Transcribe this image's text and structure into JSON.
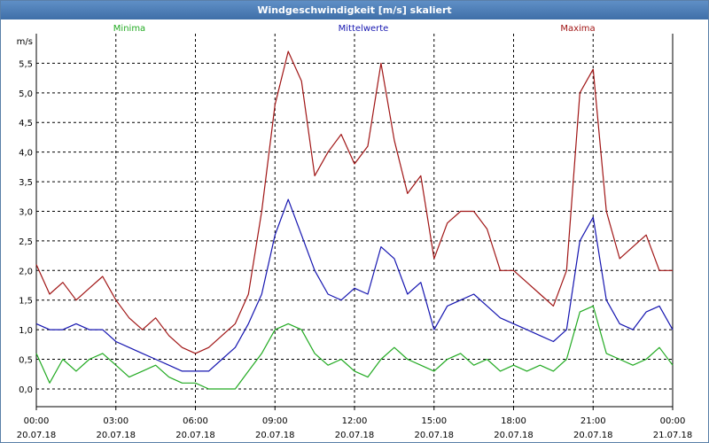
{
  "window": {
    "title": "Windgeschwindigkeit [m/s] skaliert"
  },
  "chart_data": {
    "type": "line",
    "title": "Windgeschwindigkeit [m/s] skaliert",
    "ylabel": "m/s",
    "xlabel": "",
    "ylim": [
      -0.3,
      6.0
    ],
    "xlim": [
      0,
      24
    ],
    "grid": true,
    "legend_position": "top",
    "y_ticks": [
      "0,0",
      "0,5",
      "1,0",
      "1,5",
      "2,0",
      "2,5",
      "3,0",
      "3,5",
      "4,0",
      "4,5",
      "5,0",
      "5,5"
    ],
    "y_tick_values": [
      0,
      0.5,
      1,
      1.5,
      2,
      2.5,
      3,
      3.5,
      4,
      4.5,
      5,
      5.5
    ],
    "x_ticks": [
      {
        "time": "00:00",
        "date": "20.07.18",
        "hour": 0
      },
      {
        "time": "03:00",
        "date": "20.07.18",
        "hour": 3
      },
      {
        "time": "06:00",
        "date": "20.07.18",
        "hour": 6
      },
      {
        "time": "09:00",
        "date": "20.07.18",
        "hour": 9
      },
      {
        "time": "12:00",
        "date": "20.07.18",
        "hour": 12
      },
      {
        "time": "15:00",
        "date": "20.07.18",
        "hour": 15
      },
      {
        "time": "18:00",
        "date": "20.07.18",
        "hour": 18
      },
      {
        "time": "21:00",
        "date": "20.07.18",
        "hour": 21
      },
      {
        "time": "00:00",
        "date": "21.07.18",
        "hour": 24
      }
    ],
    "x": [
      0,
      0.5,
      1,
      1.5,
      2,
      2.5,
      3,
      3.5,
      4,
      4.5,
      5,
      5.5,
      6,
      6.5,
      7,
      7.5,
      8,
      8.5,
      9,
      9.5,
      10,
      10.5,
      11,
      11.5,
      12,
      12.5,
      13,
      13.5,
      14,
      14.5,
      15,
      15.5,
      16,
      16.5,
      17,
      17.5,
      18,
      18.5,
      19,
      19.5,
      20,
      20.5,
      21,
      21.5,
      22,
      22.5,
      23,
      23.5,
      24
    ],
    "series": [
      {
        "name": "Minima",
        "color": "#22aa22",
        "values": [
          0.6,
          0.1,
          0.5,
          0.3,
          0.5,
          0.6,
          0.4,
          0.2,
          0.3,
          0.4,
          0.2,
          0.1,
          0.1,
          0.0,
          0.0,
          0.0,
          0.3,
          0.6,
          1.0,
          1.1,
          1.0,
          0.6,
          0.4,
          0.5,
          0.3,
          0.2,
          0.5,
          0.7,
          0.5,
          0.4,
          0.3,
          0.5,
          0.6,
          0.4,
          0.5,
          0.3,
          0.4,
          0.3,
          0.4,
          0.3,
          0.5,
          1.3,
          1.4,
          0.6,
          0.5,
          0.4,
          0.5,
          0.7,
          0.4
        ]
      },
      {
        "name": "Mittelwerte",
        "color": "#1515b0",
        "values": [
          1.1,
          1.0,
          1.0,
          1.1,
          1.0,
          1.0,
          0.8,
          0.7,
          0.6,
          0.5,
          0.4,
          0.3,
          0.3,
          0.3,
          0.5,
          0.7,
          1.1,
          1.6,
          2.6,
          3.2,
          2.6,
          2.0,
          1.6,
          1.5,
          1.7,
          1.6,
          2.4,
          2.2,
          1.6,
          1.8,
          1.0,
          1.4,
          1.5,
          1.6,
          1.4,
          1.2,
          1.1,
          1.0,
          0.9,
          0.8,
          1.0,
          2.5,
          2.9,
          1.5,
          1.1,
          1.0,
          1.3,
          1.4,
          1.0
        ]
      },
      {
        "name": "Maxima",
        "color": "#a01515",
        "values": [
          2.1,
          1.6,
          1.8,
          1.5,
          1.7,
          1.9,
          1.5,
          1.2,
          1.0,
          1.2,
          0.9,
          0.7,
          0.6,
          0.7,
          0.9,
          1.1,
          1.6,
          3.0,
          4.8,
          5.7,
          5.2,
          3.6,
          4.0,
          4.3,
          3.8,
          4.1,
          5.5,
          4.2,
          3.3,
          3.6,
          2.2,
          2.8,
          3.0,
          3.0,
          2.7,
          2.0,
          2.0,
          1.8,
          1.6,
          1.4,
          2.0,
          5.0,
          5.4,
          3.0,
          2.2,
          2.4,
          2.6,
          2.0,
          2.0
        ]
      }
    ]
  }
}
